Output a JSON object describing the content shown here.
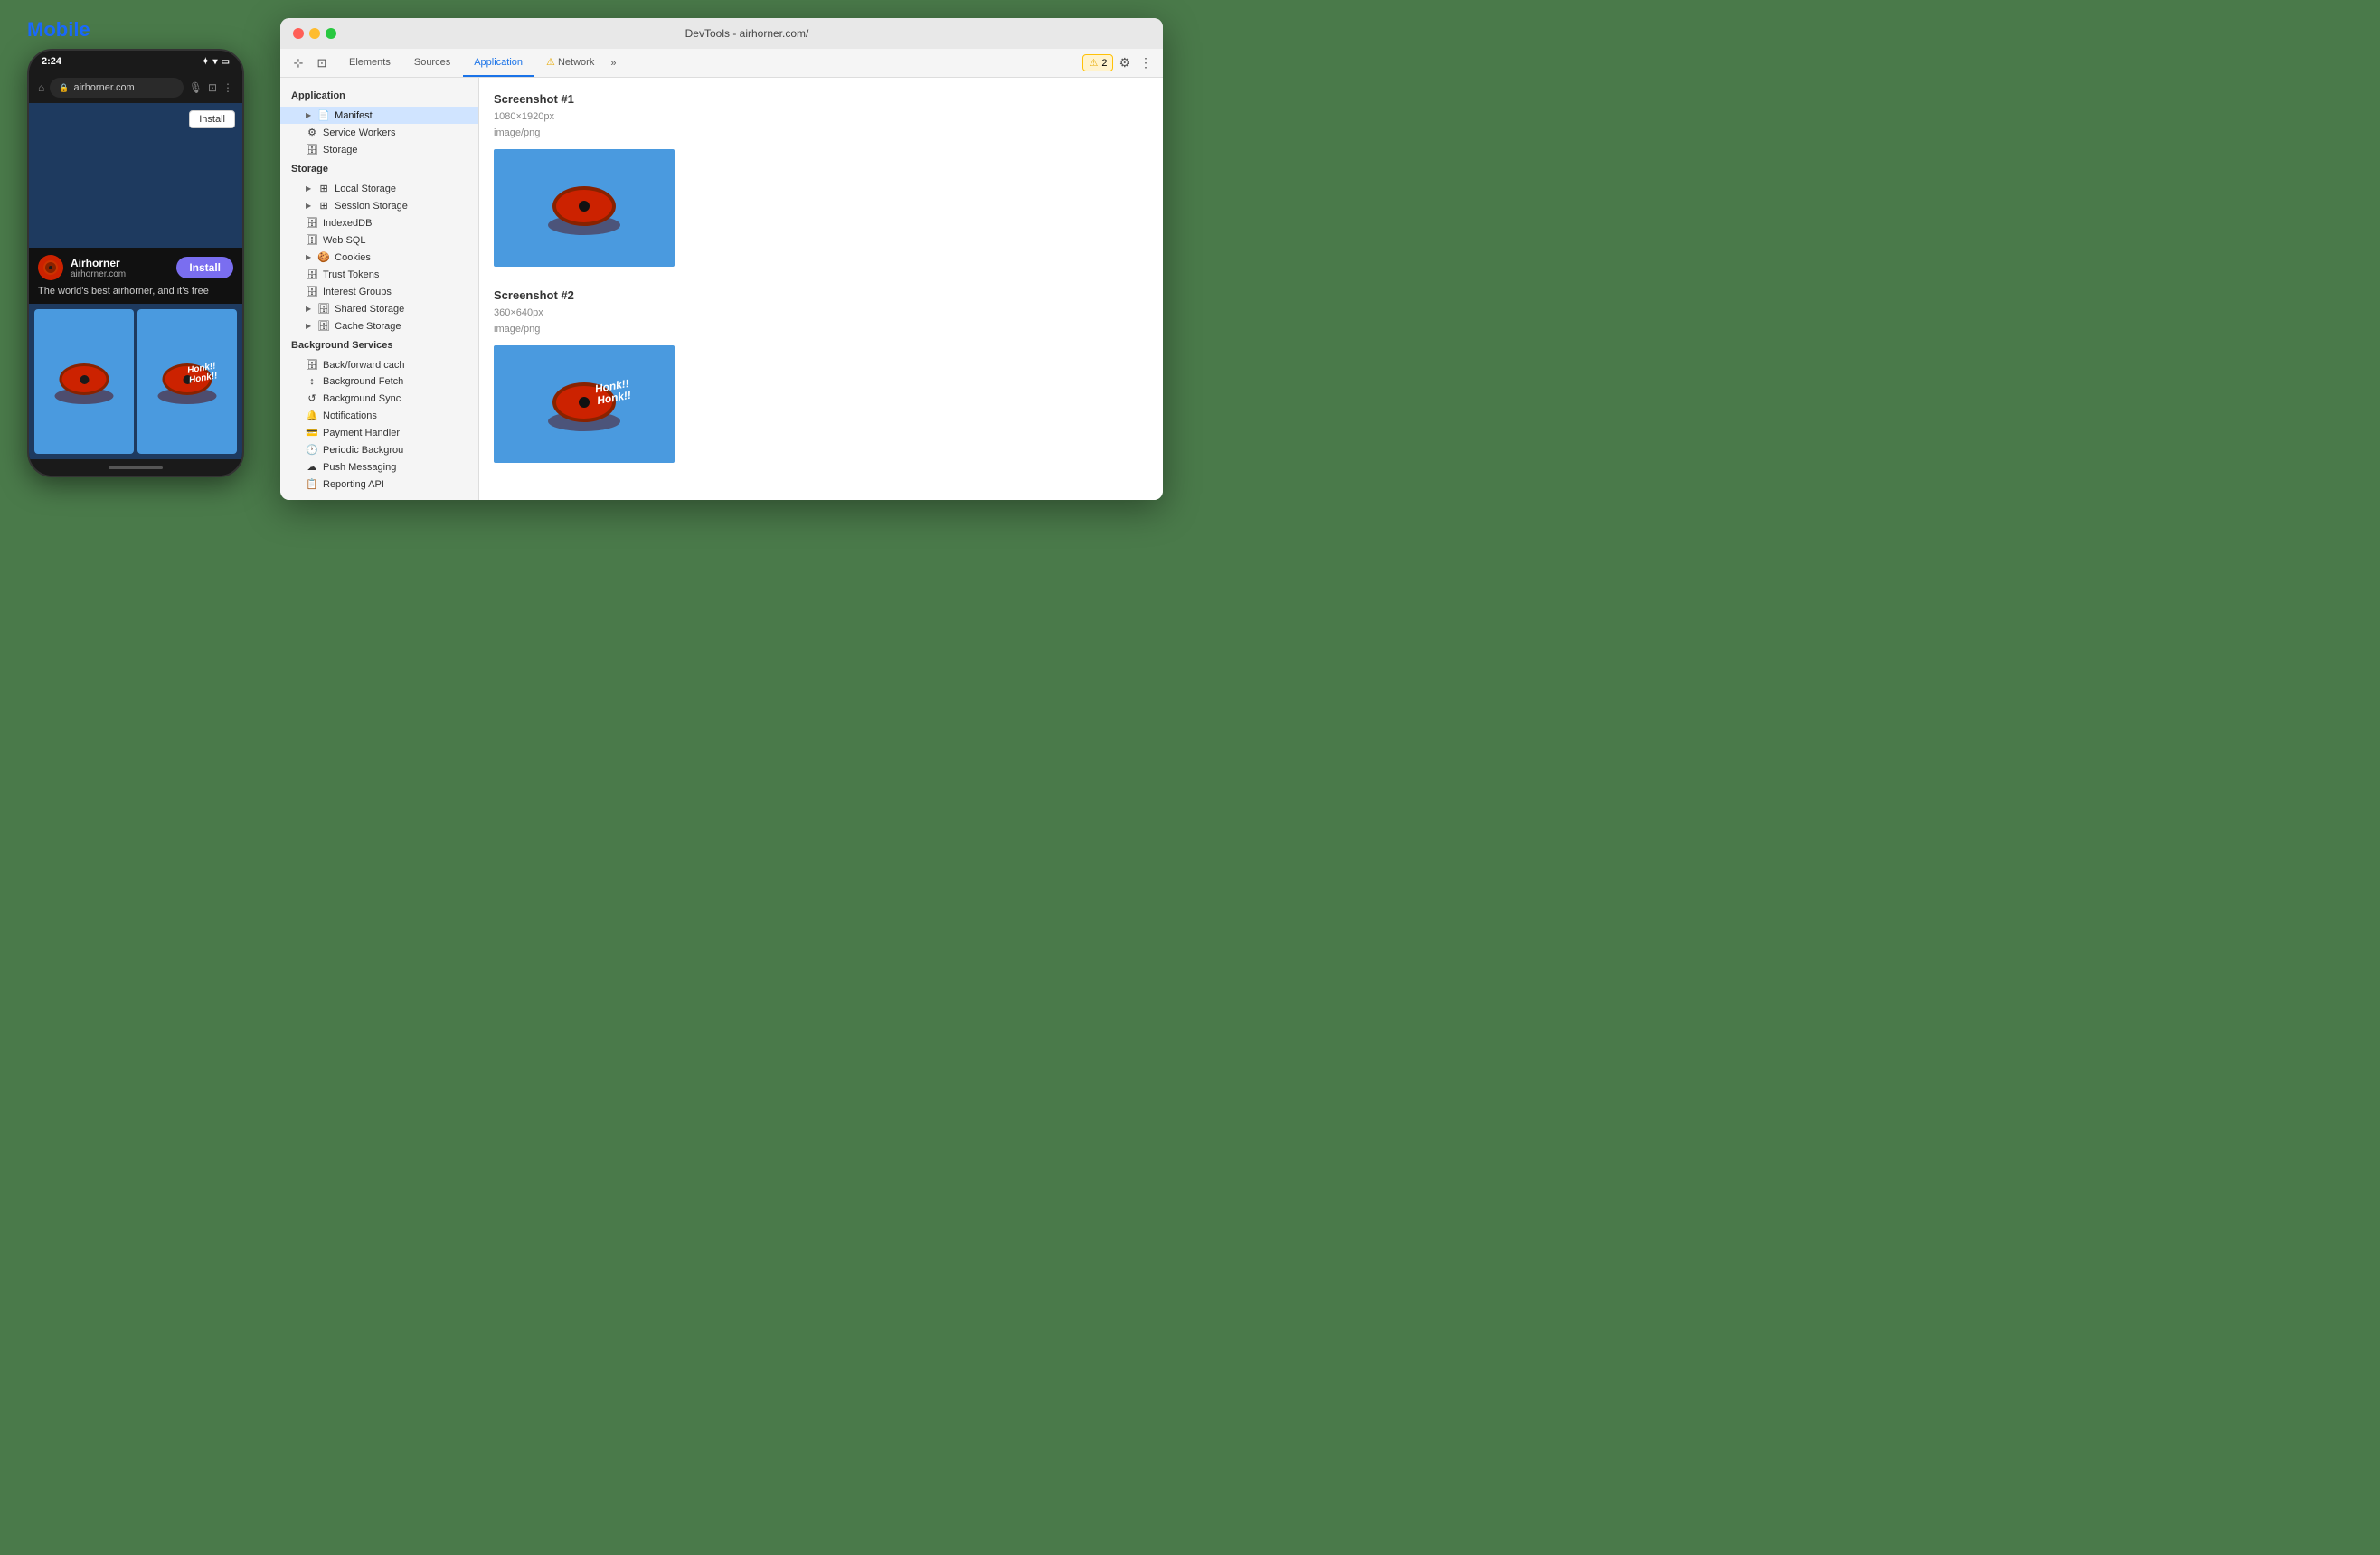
{
  "page": {
    "title": "Mobile",
    "title_color": "#1a6aff"
  },
  "phone": {
    "time": "2:24",
    "url": "airhorner.com",
    "install_button_top": "Install",
    "app_name": "Airhorner",
    "app_domain": "airhorner.com",
    "install_button": "Install",
    "tagline": "The world's best airhorner, and it's free",
    "honk_text1": "Honk!!",
    "honk_text2": "Honk!!"
  },
  "devtools": {
    "title": "DevTools - airhorner.com/",
    "tabs": [
      {
        "label": "Elements",
        "active": false
      },
      {
        "label": "Sources",
        "active": false
      },
      {
        "label": "Application",
        "active": true
      },
      {
        "label": "⚠ Network",
        "active": false
      }
    ],
    "warning_count": "2",
    "sidebar": {
      "sections": [
        {
          "label": "Application",
          "items": [
            {
              "label": "Manifest",
              "icon": "📄",
              "hasArrow": true,
              "selected": true
            },
            {
              "label": "Service Workers",
              "icon": "⚙",
              "hasArrow": false
            },
            {
              "label": "Storage",
              "icon": "🗄",
              "hasArrow": false
            }
          ]
        },
        {
          "label": "Storage",
          "items": [
            {
              "label": "Local Storage",
              "icon": "⊞",
              "hasArrow": true
            },
            {
              "label": "Session Storage",
              "icon": "⊞",
              "hasArrow": true
            },
            {
              "label": "IndexedDB",
              "icon": "🗄",
              "hasArrow": false
            },
            {
              "label": "Web SQL",
              "icon": "🗄",
              "hasArrow": false
            },
            {
              "label": "Cookies",
              "icon": "🍪",
              "hasArrow": true
            },
            {
              "label": "Trust Tokens",
              "icon": "🗄",
              "hasArrow": false
            },
            {
              "label": "Interest Groups",
              "icon": "🗄",
              "hasArrow": false
            },
            {
              "label": "Shared Storage",
              "icon": "🗄",
              "hasArrow": true
            },
            {
              "label": "Cache Storage",
              "icon": "🗄",
              "hasArrow": true
            }
          ]
        },
        {
          "label": "Background Services",
          "items": [
            {
              "label": "Back/forward cach",
              "icon": "🗄"
            },
            {
              "label": "Background Fetch",
              "icon": "↕"
            },
            {
              "label": "Background Sync",
              "icon": "↺"
            },
            {
              "label": "Notifications",
              "icon": "🔔"
            },
            {
              "label": "Payment Handler",
              "icon": "💳"
            },
            {
              "label": "Periodic Backgrou",
              "icon": "🕐"
            },
            {
              "label": "Push Messaging",
              "icon": "☁"
            },
            {
              "label": "Reporting API",
              "icon": "📋"
            }
          ]
        }
      ]
    },
    "main": {
      "screenshots": [
        {
          "title": "Screenshot #1",
          "dimensions": "1080×1920px",
          "type": "image/png",
          "hasHonk": false
        },
        {
          "title": "Screenshot #2",
          "dimensions": "360×640px",
          "type": "image/png",
          "hasHonk": true
        }
      ]
    }
  }
}
